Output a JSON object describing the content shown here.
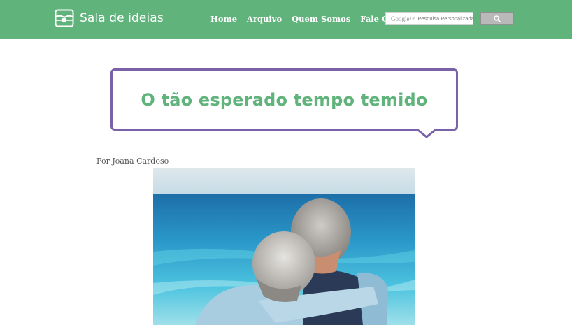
{
  "site": {
    "name": "Sala de ideias",
    "logo_icon": "treasure-chest-icon"
  },
  "nav": {
    "items": [
      {
        "label": "Home"
      },
      {
        "label": "Arquivo"
      },
      {
        "label": "Quem Somos"
      },
      {
        "label": "Fale Conosco"
      }
    ]
  },
  "search": {
    "brand": "Google™",
    "placeholder": "Pesquisa Personalizada",
    "button_icon": "search-icon"
  },
  "article": {
    "title": "O tão esperado tempo temido",
    "byline": "Por Joana Cardoso",
    "image_icon": "elderly-couple-beach-photo"
  },
  "colors": {
    "header_green": "#5fb37b",
    "bubble_purple": "#7a62a8",
    "title_green": "#5fb37b"
  }
}
